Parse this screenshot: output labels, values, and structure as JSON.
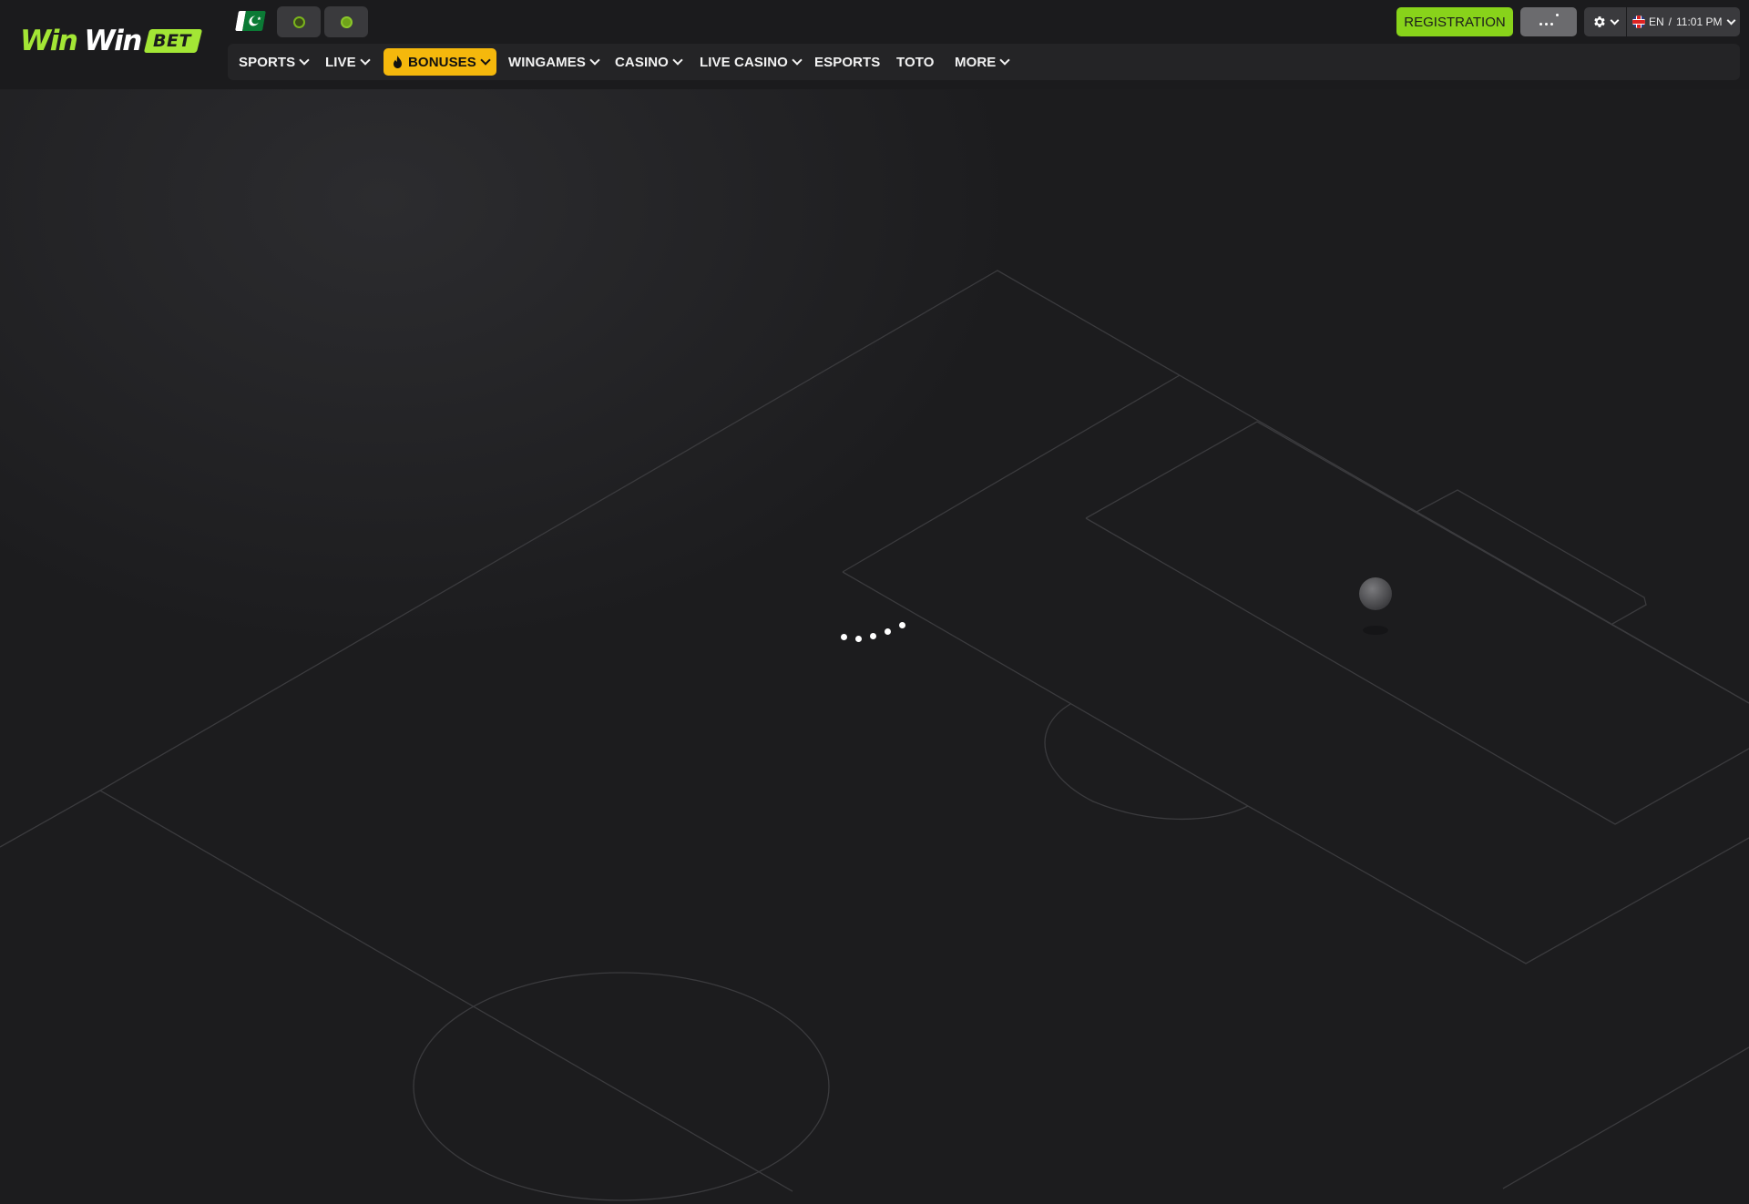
{
  "brand": {
    "logo_word_1": "Win",
    "logo_word_2": "Win",
    "logo_badge": "BET",
    "accent_color": "#a3e635"
  },
  "top_icons": {
    "country_flag": "pakistan-flag-icon",
    "button_1_icon": "live-indicator-icon",
    "button_2_icon": "tennis-ball-icon"
  },
  "nav": {
    "items": [
      {
        "label": "SPORTS",
        "has_dropdown": true
      },
      {
        "label": "LIVE",
        "has_dropdown": true
      },
      {
        "label": "BONUSES",
        "has_dropdown": true,
        "highlight_color": "#f5b80c"
      },
      {
        "label": "WINGAMES",
        "has_dropdown": true
      },
      {
        "label": "CASINO",
        "has_dropdown": true
      },
      {
        "label": "LIVE CASINO",
        "has_dropdown": true
      },
      {
        "label": "ESPORTS",
        "has_dropdown": false
      },
      {
        "label": "TOTO",
        "has_dropdown": false
      },
      {
        "label": "MORE",
        "has_dropdown": true
      }
    ]
  },
  "account": {
    "registration_label": "REGISTRATION",
    "registration_color": "#88d31a",
    "login_icon": "loading-dots-icon",
    "settings_icon": "gear-icon",
    "language": "EN",
    "separator": "/",
    "time": "11:01 PM",
    "language_flag": "uk-flag-icon"
  },
  "main": {
    "background": "soccer-field-outline",
    "loading_indicator": "loading-dots-icon"
  }
}
